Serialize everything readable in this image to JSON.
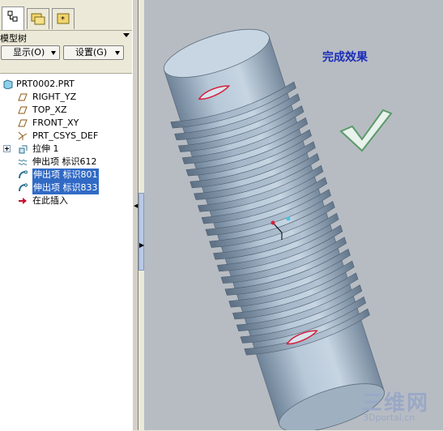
{
  "model_tree": {
    "title": "模型树",
    "show_button": "显示(O)",
    "settings_button": "设置(G)",
    "items": [
      {
        "label": "PRT0002.PRT",
        "icon": "part-icon"
      },
      {
        "label": "RIGHT_YZ",
        "icon": "datum-plane-icon"
      },
      {
        "label": "TOP_XZ",
        "icon": "datum-plane-icon"
      },
      {
        "label": "FRONT_XY",
        "icon": "datum-plane-icon"
      },
      {
        "label": "PRT_CSYS_DEF",
        "icon": "csys-icon"
      },
      {
        "label": "拉伸 1",
        "icon": "extrude-icon"
      },
      {
        "label": "伸出项 标识612",
        "icon": "protrusion-helical-icon"
      },
      {
        "label": "伸出项 标识801",
        "icon": "protrusion-sweep-icon"
      },
      {
        "label": "伸出项 标识833",
        "icon": "protrusion-sweep-icon"
      },
      {
        "label": "在此插入",
        "icon": "insert-here-arrow-icon"
      }
    ]
  },
  "viewport": {
    "result_label": "完成效果",
    "watermark_cn": "三维网",
    "watermark_en": "3Dportal.cn"
  },
  "colors": {
    "selection": "#316ac5",
    "viewport_bg": "#b7bcc3",
    "label_blue": "#1b2db8",
    "check_green": "#5c9a6a",
    "highlight_red": "#d4213b"
  }
}
